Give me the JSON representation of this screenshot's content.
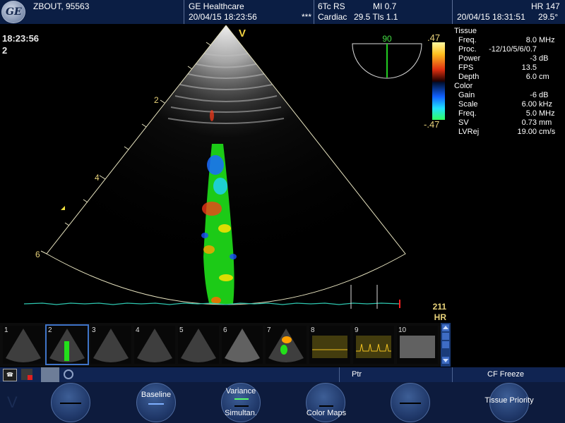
{
  "header": {
    "patient": "ZBOUT, 95563",
    "institution": "GE Healthcare",
    "datetime_left": "20/04/15 18:23:56",
    "stars": "***",
    "probe": "6Tc RS",
    "mi": "MI 0.7",
    "preset": "Cardiac",
    "tis": "29.5 Tls 1.1",
    "hr": "HR 147",
    "datetime_right": "20/04/15 18:31:51",
    "angle": "29.5°"
  },
  "left_info": {
    "time": "18:23:56",
    "index": "2"
  },
  "image": {
    "mode_marker": "V",
    "depth_labels": [
      "2",
      "4",
      "6"
    ],
    "hr_value": "211",
    "hr_label": "HR"
  },
  "probe_indicator": {
    "angle_value": "90"
  },
  "color_scale": {
    "top": ".47",
    "bottom": "-.47"
  },
  "tissue_params": {
    "title": "Tissue",
    "rows": [
      {
        "label": "Freq.",
        "value": "8.0",
        "unit": "MHz"
      },
      {
        "label": "Proc.",
        "value": "-12/10/5/6/0.7",
        "unit": ""
      },
      {
        "label": "Power",
        "value": "-3",
        "unit": "dB"
      },
      {
        "label": "FPS",
        "value": "13.5",
        "unit": ""
      },
      {
        "label": "Depth",
        "value": "6.0",
        "unit": "cm"
      }
    ]
  },
  "color_params": {
    "title": "Color",
    "rows": [
      {
        "label": "Gain",
        "value": "-6",
        "unit": "dB"
      },
      {
        "label": "Scale",
        "value": "6.00",
        "unit": "kHz"
      },
      {
        "label": "Freq.",
        "value": "5.0",
        "unit": "MHz"
      },
      {
        "label": "SV",
        "value": "0.73",
        "unit": "mm"
      },
      {
        "label": "LVRej",
        "value": "19.00",
        "unit": "cm/s"
      }
    ]
  },
  "thumbnails": [
    "1",
    "2",
    "3",
    "4",
    "5",
    "6",
    "7",
    "8",
    "9",
    "10"
  ],
  "status": {
    "ptr": "Ptr",
    "cf_freeze": "CF Freeze"
  },
  "softkeys": {
    "baseline": "Baseline",
    "variance": "Variance",
    "simultan": "Simultan.",
    "color_maps": "Color Maps",
    "tissue_priority": "Tissue Priority"
  },
  "colors": {
    "header_bg": "#0b1e44",
    "accent_yellow": "#e8d27a",
    "ecg_trace": "#2ec7b0",
    "doppler_green": "#22e01a"
  }
}
